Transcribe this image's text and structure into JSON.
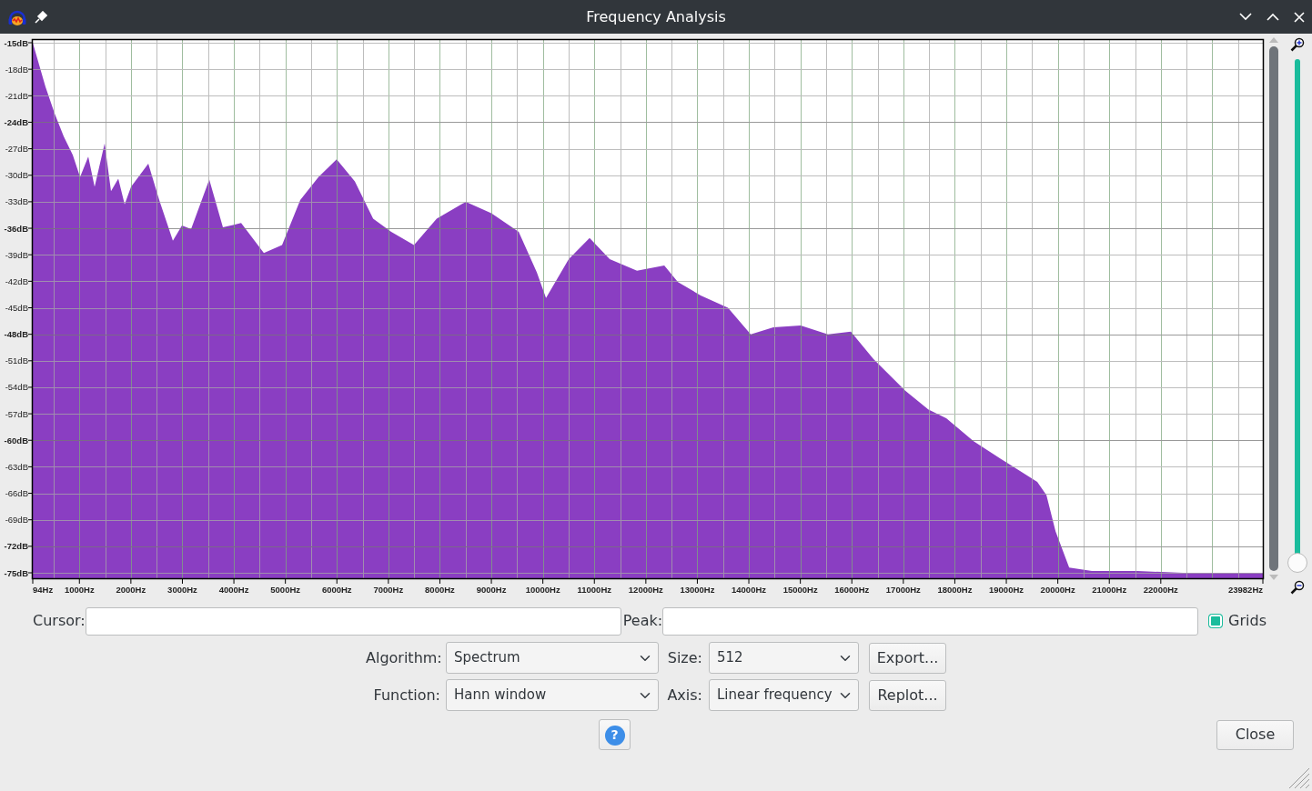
{
  "window": {
    "title": "Frequency Analysis"
  },
  "plot": {
    "chart_data": {
      "type": "area",
      "x": [
        94,
        341,
        518,
        695,
        871,
        1013,
        1172,
        1296,
        1490,
        1614,
        1755,
        1879,
        2002,
        2338,
        2550,
        2815,
        2992,
        3169,
        3522,
        3787,
        4140,
        4582,
        4936,
        5289,
        5642,
        5996,
        6349,
        6703,
        7056,
        7498,
        7939,
        8505,
        8999,
        9530,
        9883,
        10060,
        10502,
        10908,
        11297,
        11827,
        12357,
        12622,
        13064,
        13594,
        14036,
        14477,
        15007,
        15537,
        15979,
        16421,
        17039,
        17481,
        17834,
        18364,
        18894,
        19601,
        19778,
        19955,
        20220,
        20662,
        21545,
        22429,
        23136,
        23982
      ],
      "series": [
        {
          "color": "#8a3ec2",
          "values": [
            -15,
            -20,
            -23,
            -25.6,
            -27.7,
            -30.2,
            -27.9,
            -31.3,
            -26.4,
            -31.8,
            -30.4,
            -33.3,
            -31.3,
            -28.7,
            -32.8,
            -37.4,
            -35.7,
            -36.1,
            -30.5,
            -35.9,
            -35.4,
            -38.8,
            -37.9,
            -32.8,
            -30.2,
            -28.2,
            -30.7,
            -34.9,
            -36.4,
            -37.9,
            -34.9,
            -33,
            -34.3,
            -36.4,
            -41,
            -43.9,
            -39.5,
            -37.1,
            -39.5,
            -40.8,
            -40.2,
            -42.1,
            -43.6,
            -45,
            -48,
            -47.2,
            -47,
            -48,
            -47.7,
            -50.8,
            -54.4,
            -56.5,
            -57.5,
            -60.1,
            -62.1,
            -64.7,
            -66.2,
            -70.3,
            -74.4,
            -74.8,
            -74.8,
            -75,
            -75,
            -75
          ]
        }
      ],
      "xlim": [
        94,
        23982
      ],
      "ylim": [
        -75,
        -15
      ],
      "grid": true,
      "xticks": [
        {
          "value": 94,
          "label": "94Hz"
        },
        {
          "value": 1000,
          "label": "1000Hz"
        },
        {
          "value": 2000,
          "label": "2000Hz"
        },
        {
          "value": 3000,
          "label": "3000Hz"
        },
        {
          "value": 4000,
          "label": "4000Hz"
        },
        {
          "value": 5000,
          "label": "5000Hz"
        },
        {
          "value": 6000,
          "label": "6000Hz"
        },
        {
          "value": 7000,
          "label": "7000Hz"
        },
        {
          "value": 8000,
          "label": "8000Hz"
        },
        {
          "value": 9000,
          "label": "9000Hz"
        },
        {
          "value": 10000,
          "label": "10000Hz"
        },
        {
          "value": 11000,
          "label": "11000Hz"
        },
        {
          "value": 12000,
          "label": "12000Hz"
        },
        {
          "value": 13000,
          "label": "13000Hz"
        },
        {
          "value": 14000,
          "label": "14000Hz"
        },
        {
          "value": 15000,
          "label": "15000Hz"
        },
        {
          "value": 16000,
          "label": "16000Hz"
        },
        {
          "value": 17000,
          "label": "17000Hz"
        },
        {
          "value": 18000,
          "label": "18000Hz"
        },
        {
          "value": 19000,
          "label": "19000Hz"
        },
        {
          "value": 20000,
          "label": "20000Hz"
        },
        {
          "value": 21000,
          "label": "21000Hz"
        },
        {
          "value": 22000,
          "label": "22000Hz"
        },
        {
          "value": 23982,
          "label": "23982Hz"
        }
      ],
      "yticks": [
        {
          "value": -15,
          "label": "-15dB"
        },
        {
          "value": -18,
          "label": "-18dB"
        },
        {
          "value": -21,
          "label": "-21dB"
        },
        {
          "value": -24,
          "label": "-24dB"
        },
        {
          "value": -27,
          "label": "-27dB"
        },
        {
          "value": -30,
          "label": "-30dB"
        },
        {
          "value": -33,
          "label": "-33dB"
        },
        {
          "value": -36,
          "label": "-36dB"
        },
        {
          "value": -39,
          "label": "-39dB"
        },
        {
          "value": -42,
          "label": "-42dB"
        },
        {
          "value": -45,
          "label": "-45dB"
        },
        {
          "value": -48,
          "label": "-48dB"
        },
        {
          "value": -51,
          "label": "-51dB"
        },
        {
          "value": -54,
          "label": "-54dB"
        },
        {
          "value": -57,
          "label": "-57dB"
        },
        {
          "value": -60,
          "label": "-60dB"
        },
        {
          "value": -63,
          "label": "-63dB"
        },
        {
          "value": -66,
          "label": "-66dB"
        },
        {
          "value": -69,
          "label": "-69dB"
        },
        {
          "value": -72,
          "label": "-72dB"
        },
        {
          "value": -75,
          "label": "-75dB"
        }
      ]
    }
  },
  "zoom_slider": {
    "level": 1
  },
  "cursor": {
    "label": "Cursor:"
  },
  "peak": {
    "label": "Peak:"
  },
  "grids": {
    "label": "Grids",
    "checked": true
  },
  "settings": [
    {
      "label": "Algorithm:",
      "value": "Spectrum"
    },
    {
      "label": "Size:",
      "value": "512"
    },
    {
      "label": "Function:",
      "value": "Hann window"
    },
    {
      "label": "Axis:",
      "value": "Linear frequency"
    }
  ],
  "buttons": {
    "export": "Export...",
    "replot": "Replot...",
    "help": "?",
    "close": "Close"
  }
}
